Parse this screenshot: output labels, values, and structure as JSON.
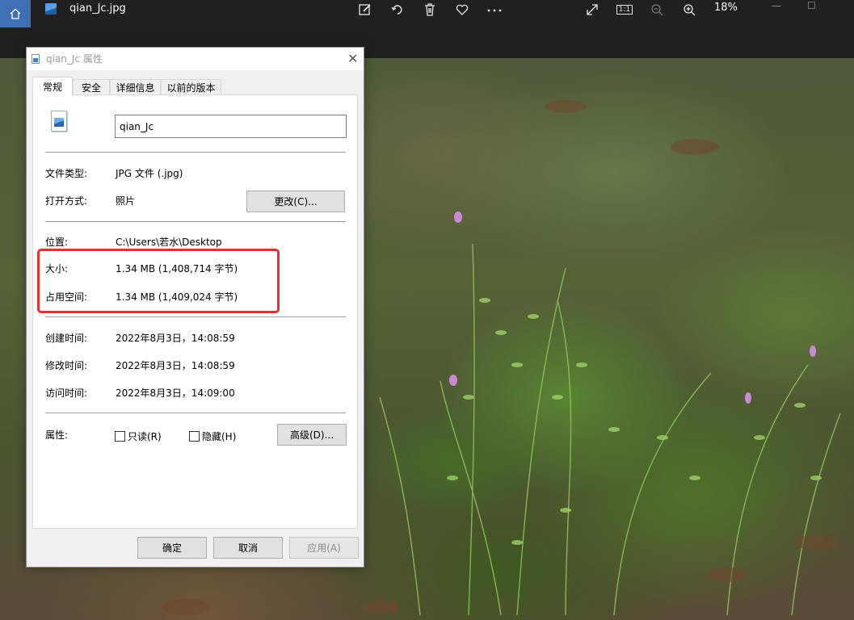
{
  "viewer": {
    "file_title": "qian_Jc.jpg",
    "zoom": "18%",
    "actual_size_label": "1:1",
    "icons": [
      "home-icon",
      "edit-icon",
      "rotate-icon",
      "delete-icon",
      "favorite-icon",
      "more-icon",
      "fullscreen-icon",
      "actual-size-icon",
      "zoom-out-icon",
      "zoom-in-icon"
    ]
  },
  "dialog": {
    "title": "qian_Jc 属性",
    "tabs": [
      {
        "label": "常规"
      },
      {
        "label": "安全"
      },
      {
        "label": "详细信息"
      },
      {
        "label": "以前的版本"
      }
    ],
    "file_name": "qian_Jc",
    "type": {
      "label": "文件类型:",
      "value": "JPG 文件 (.jpg)"
    },
    "opens_with": {
      "label": "打开方式:",
      "value": "照片",
      "change_button": "更改(C)..."
    },
    "location": {
      "label": "位置:",
      "value": "C:\\Users\\若水\\Desktop"
    },
    "size": {
      "label": "大小:",
      "value": "1.34 MB (1,408,714 字节)"
    },
    "size_on_disk": {
      "label": "占用空间:",
      "value": "1.34 MB (1,409,024 字节)"
    },
    "created": {
      "label": "创建时间:",
      "value": "2022年8月3日，14:08:59"
    },
    "modified": {
      "label": "修改时间:",
      "value": "2022年8月3日，14:08:59"
    },
    "accessed": {
      "label": "访问时间:",
      "value": "2022年8月3日，14:09:00"
    },
    "attributes": {
      "label": "属性:",
      "readonly": {
        "label": "只读(R)",
        "checked": false
      },
      "hidden": {
        "label": "隐藏(H)",
        "checked": false
      },
      "advanced_button": "高级(D)..."
    },
    "buttons": {
      "ok": "确定",
      "cancel": "取消",
      "apply": "应用(A)"
    }
  },
  "colors": {
    "highlight": "#e8312c",
    "home_button": "#3f6fb5",
    "topbar": "#202020"
  }
}
